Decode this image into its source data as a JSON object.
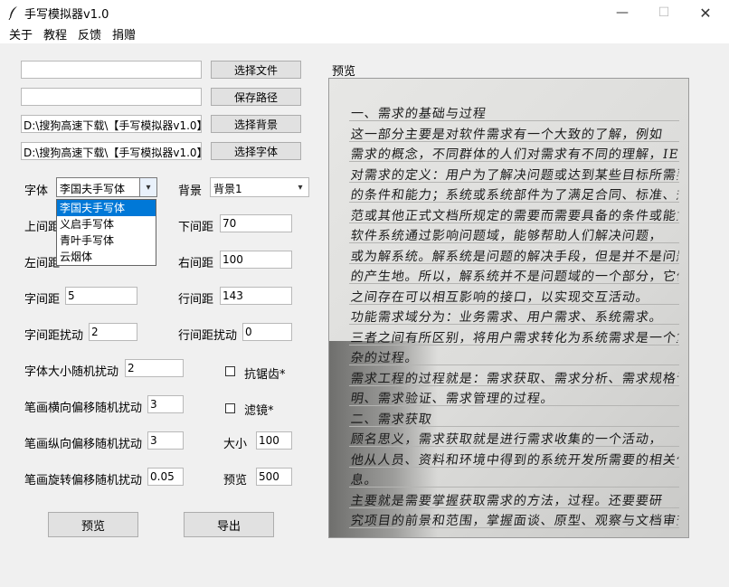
{
  "window": {
    "title": "手写模拟器v1.0",
    "controls": {
      "minimize": "—",
      "maximize": "☐",
      "close": "✕"
    }
  },
  "menu": {
    "items": [
      "关于",
      "教程",
      "反馈",
      "捐赠"
    ]
  },
  "files": {
    "input1_value": "",
    "btn_select_file": "选择文件",
    "input2_value": "",
    "btn_save_path": "保存路径",
    "background_path": "D:\\搜狗高速下载\\【手写模拟器v1.0】",
    "btn_select_background": "选择背景",
    "font_path": "D:\\搜狗高速下载\\【手写模拟器v1.0】",
    "btn_select_font": "选择字体"
  },
  "settings": {
    "font_label": "字体",
    "font_value": "李国夫手写体",
    "font_options": [
      "李国夫手写体",
      "义启手写体",
      "青叶手写体",
      "云烟体"
    ],
    "bg_label": "背景",
    "bg_value": "背景1",
    "top_margin_label": "上间距",
    "bottom_margin_label": "下间距",
    "bottom_margin_value": "70",
    "left_margin_label": "左间距",
    "right_margin_label": "右间距",
    "right_margin_value": "100",
    "char_spacing_label": "字间距",
    "char_spacing_value": "5",
    "line_spacing_label": "行间距",
    "line_spacing_value": "143",
    "char_jitter_label": "字间距扰动",
    "char_jitter_value": "2",
    "line_jitter_label": "行间距扰动",
    "line_jitter_value": "0",
    "font_size_random_label": "字体大小随机扰动",
    "font_size_random_value": "2",
    "antialias_label": "抗锯齿*",
    "stroke_h_label": "笔画横向偏移随机扰动",
    "stroke_h_value": "3",
    "filter_label": "滤镜*",
    "stroke_v_label": "笔画纵向偏移随机扰动",
    "stroke_v_value": "3",
    "size_label": "大小",
    "size_value": "100",
    "stroke_rot_label": "笔画旋转偏移随机扰动",
    "stroke_rot_value": "0.05",
    "preview_label": "预览",
    "preview_value": "500"
  },
  "actions": {
    "preview_button": "预览",
    "export_button": "导出"
  },
  "preview_panel": {
    "label": "预览",
    "lines": [
      "一、需求的基础与过程",
      "这一部分主要是对软件需求有一个大致的了解，例如",
      "需求的概念，不同群体的人们对需求有不同的理解，IEEE",
      "对需求的定义：用户为了解决问题或达到某些目标所需要",
      "的条件和能力；系统或系统部件为了满足合同、标准、规",
      "范或其他正式文档所规定的需要而需要具备的条件或能力。",
      "软件系统通过影响问题域，能够帮助人们解决问题，",
      "或为解系统。解系统是问题的解决手段，但是并不是问题",
      "的产生地。所以，解系统并不是问题域的一个部分，它们",
      "之间存在可以相互影响的接口，以实现交互活动。",
      "功能需求域分为：业务需求、用户需求、系统需求。",
      "三者之间有所区别，将用户需求转化为系统需求是一个复",
      "杂的过程。",
      "需求工程的过程就是：需求获取、需求分析、需求规格说",
      "明、需求验证、需求管理的过程。",
      "二、需求获取",
      "顾名思义，需求获取就是进行需求收集的一个活动，",
      "他从人员、资料和环境中得到的系统开发所需要的相关信",
      "息。",
      "主要就是需要掌握获取需求的方法，过程。还要要研",
      "究项目的前景和范围，掌握面谈、原型、观察与文档审查"
    ]
  }
}
